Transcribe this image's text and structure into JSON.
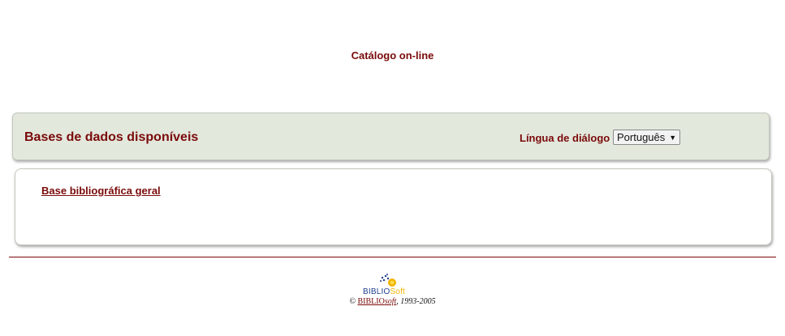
{
  "page": {
    "title": "Catálogo on-line"
  },
  "databases": {
    "heading": "Bases de dados disponíveis",
    "language_label": "Língua de diálogo",
    "language_selected": "Português",
    "items": [
      {
        "label": "Base bibliográfica geral"
      }
    ]
  },
  "footer": {
    "logo_text_a": "BIBLIO",
    "logo_text_b": "Soft",
    "copyright_symbol": "©",
    "brand_a": "BIBLIO",
    "brand_b": "soft",
    "years": ", 1993-2005"
  },
  "colors": {
    "accent": "#7a0a0a",
    "panel": "#e3e8dd",
    "logo_blue": "#1f3f8f",
    "logo_yellow": "#f0b400"
  }
}
